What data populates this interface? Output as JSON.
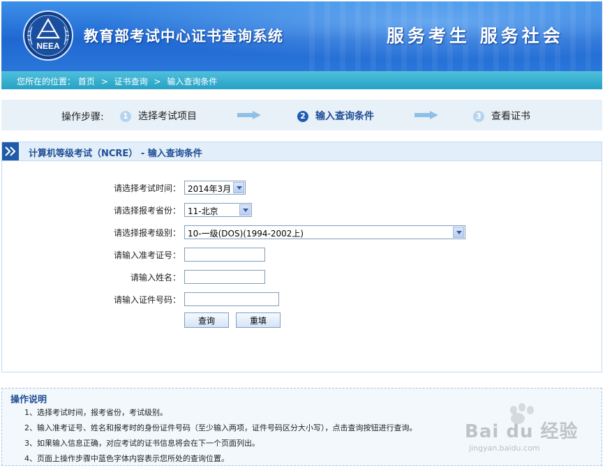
{
  "header": {
    "logo_text": "NEEA",
    "title": "教育部考试中心证书查询系统",
    "slogan": "服务考生  服务社会"
  },
  "breadcrumb": {
    "prefix": "您所在的位置：",
    "items": [
      "首页",
      "证书查询",
      "输入查询条件"
    ],
    "separator": ">"
  },
  "steps": {
    "label": "操作步骤:",
    "items": [
      {
        "num": "1",
        "label": "选择考试项目",
        "active": false
      },
      {
        "num": "2",
        "label": "输入查询条件",
        "active": true
      },
      {
        "num": "3",
        "label": "查看证书",
        "active": false
      }
    ]
  },
  "panel": {
    "title": "计算机等级考试（NCRE） - 输入查询条件"
  },
  "form": {
    "exam_time_label": "请选择考试时间：",
    "exam_time_value": "2014年3月",
    "province_label": "请选择报考省份：",
    "province_value": "11-北京",
    "level_label": "请选择报考级别：",
    "level_value": "10-一级(DOS)(1994-2002上)",
    "ticket_label": "请输入准考证号：",
    "ticket_value": "",
    "name_label": "请输入姓名：",
    "name_value": "",
    "id_label": "请输入证件号码：",
    "id_value": "",
    "query_button": "查询",
    "reset_button": "重填"
  },
  "instructions": {
    "title": "操作说明",
    "items": [
      "1、选择考试时间，报考省份，考试级别。",
      "2、输入准考证号、姓名和报考时的身份证件号码（至少输入两项，证件号码区分大小写），点击查询按钮进行查询。",
      "3、如果输入信息正确，对应考试的证书信息将会在下一个页面列出。",
      "4、页面上操作步骤中蓝色字体内容表示您所处的查询位置。"
    ]
  },
  "watermark": {
    "brand": "Bai du 经验",
    "url": "jingyan.baidu.com"
  },
  "colors": {
    "header_blue": "#1f68d2",
    "breadcrumb_teal": "#26a1c4",
    "active_step": "#1f4e95",
    "panel_border": "#c4d9ee"
  }
}
